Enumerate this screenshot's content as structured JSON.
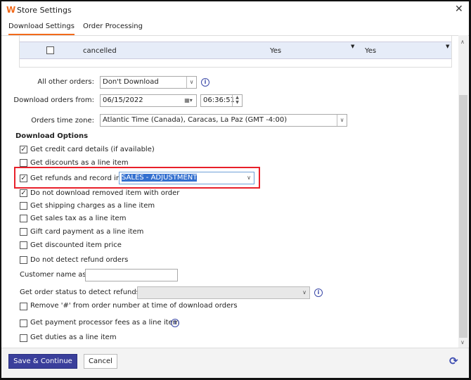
{
  "window": {
    "title": "Store Settings",
    "close": "✕"
  },
  "tabs": [
    {
      "label": "Download Settings"
    },
    {
      "label": "Order Processing"
    }
  ],
  "grid": {
    "row": {
      "status": "cancelled",
      "col1": "Yes",
      "col2": "Yes"
    }
  },
  "form": {
    "all_other_orders_label": "All other orders:",
    "all_other_orders_value": "Don't Download",
    "download_from_label": "Download orders from:",
    "date": "06/15/2022",
    "time": "06:36:51",
    "timezone_label": "Orders time zone:",
    "timezone": "Atlantic Time (Canada), Caracas, La Paz (GMT -4:00)",
    "section": "Download Options",
    "options": [
      {
        "label": "Get credit card details (if available)",
        "checked": true
      },
      {
        "label": "Get discounts as a line item",
        "checked": false
      },
      {
        "label": "Get refunds and record in:",
        "checked": true
      },
      {
        "label": "Do not download removed item with order",
        "checked": true
      },
      {
        "label": "Get shipping charges as a line item",
        "checked": false
      },
      {
        "label": "Get sales tax as a line item",
        "checked": false
      },
      {
        "label": "Gift card payment as a line item",
        "checked": false
      },
      {
        "label": "Get discounted item price",
        "checked": false
      },
      {
        "label": "Do not detect refund orders",
        "checked": false
      }
    ],
    "refund_account": "SALES - ADJUSTMENT",
    "customer_name_label": "Customer name as:",
    "customer_name_value": "",
    "order_status_label": "Get order status to detect refunds:",
    "order_status_value": "",
    "options2": [
      {
        "label": "Remove '#' from order number at time of download orders",
        "checked": false
      },
      {
        "label": "Get payment processor fees as a line item",
        "checked": false
      },
      {
        "label": "Get duties as a line item",
        "checked": false
      }
    ]
  },
  "footer": {
    "save": "Save & Continue",
    "cancel": "Cancel"
  },
  "colors": {
    "accent": "#f26a1b",
    "primary": "#3a3f9b",
    "highlight": "#e8202a"
  }
}
